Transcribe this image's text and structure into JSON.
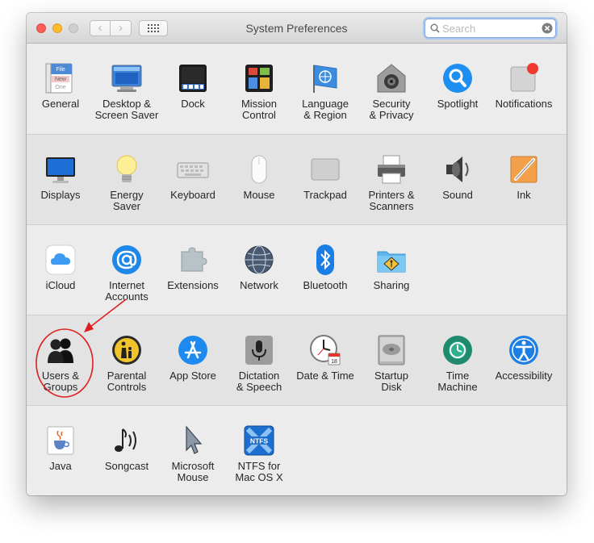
{
  "window": {
    "title": "System Preferences",
    "search": {
      "placeholder": "Search",
      "value": ""
    }
  },
  "sections": [
    {
      "items": [
        {
          "name": "general",
          "label": "General",
          "icon": "general-icon",
          "icon_text": [
            "File",
            "New",
            "One"
          ]
        },
        {
          "name": "desktop-screen-saver",
          "label": "Desktop &\nScreen Saver",
          "icon": "desktop-icon"
        },
        {
          "name": "dock",
          "label": "Dock",
          "icon": "dock-icon"
        },
        {
          "name": "mission-control",
          "label": "Mission\nControl",
          "icon": "mission-control-icon"
        },
        {
          "name": "language-region",
          "label": "Language\n& Region",
          "icon": "un-flag-icon"
        },
        {
          "name": "security-privacy",
          "label": "Security\n& Privacy",
          "icon": "house-safe-icon"
        },
        {
          "name": "spotlight",
          "label": "Spotlight",
          "icon": "magnifier-icon"
        },
        {
          "name": "notifications",
          "label": "Notifications",
          "icon": "notification-badge-icon"
        }
      ]
    },
    {
      "items": [
        {
          "name": "displays",
          "label": "Displays",
          "icon": "monitor-icon"
        },
        {
          "name": "energy-saver",
          "label": "Energy\nSaver",
          "icon": "lightbulb-icon"
        },
        {
          "name": "keyboard",
          "label": "Keyboard",
          "icon": "keyboard-icon"
        },
        {
          "name": "mouse",
          "label": "Mouse",
          "icon": "mouse-icon"
        },
        {
          "name": "trackpad",
          "label": "Trackpad",
          "icon": "trackpad-icon"
        },
        {
          "name": "printers-scanners",
          "label": "Printers &\nScanners",
          "icon": "printer-icon"
        },
        {
          "name": "sound",
          "label": "Sound",
          "icon": "speaker-icon"
        },
        {
          "name": "ink",
          "label": "Ink",
          "icon": "pen-tablet-icon"
        }
      ]
    },
    {
      "items": [
        {
          "name": "icloud",
          "label": "iCloud",
          "icon": "cloud-icon"
        },
        {
          "name": "internet-accounts",
          "label": "Internet\nAccounts",
          "icon": "at-sign-icon"
        },
        {
          "name": "extensions",
          "label": "Extensions",
          "icon": "puzzle-piece-icon"
        },
        {
          "name": "network",
          "label": "Network",
          "icon": "globe-icon"
        },
        {
          "name": "bluetooth",
          "label": "Bluetooth",
          "icon": "bluetooth-icon"
        },
        {
          "name": "sharing",
          "label": "Sharing",
          "icon": "shared-folder-icon"
        }
      ]
    },
    {
      "items": [
        {
          "name": "users-groups",
          "label": "Users &\nGroups",
          "icon": "users-silhouette-icon"
        },
        {
          "name": "parental-controls",
          "label": "Parental\nControls",
          "icon": "parental-sign-icon"
        },
        {
          "name": "app-store",
          "label": "App Store",
          "icon": "app-store-icon"
        },
        {
          "name": "dictation-speech",
          "label": "Dictation\n& Speech",
          "icon": "microphone-icon"
        },
        {
          "name": "date-time",
          "label": "Date & Time",
          "icon": "clock-calendar-icon",
          "icon_text": [
            "18"
          ]
        },
        {
          "name": "startup-disk",
          "label": "Startup\nDisk",
          "icon": "hard-disk-icon"
        },
        {
          "name": "time-machine",
          "label": "Time\nMachine",
          "icon": "time-machine-icon"
        },
        {
          "name": "accessibility",
          "label": "Accessibility",
          "icon": "accessibility-icon"
        }
      ]
    },
    {
      "items": [
        {
          "name": "java",
          "label": "Java",
          "icon": "java-cup-icon"
        },
        {
          "name": "songcast",
          "label": "Songcast",
          "icon": "music-note-icon"
        },
        {
          "name": "microsoft-mouse",
          "label": "Microsoft\nMouse",
          "icon": "cursor-arrow-icon"
        },
        {
          "name": "ntfs-for-mac",
          "label": "NTFS for\nMac OS X",
          "icon": "ntfs-icon",
          "icon_text": [
            "NTFS"
          ]
        }
      ]
    }
  ],
  "annotation": {
    "target": "users-groups",
    "color": "#e01e1e",
    "shapes": [
      "circle",
      "arrow"
    ]
  }
}
